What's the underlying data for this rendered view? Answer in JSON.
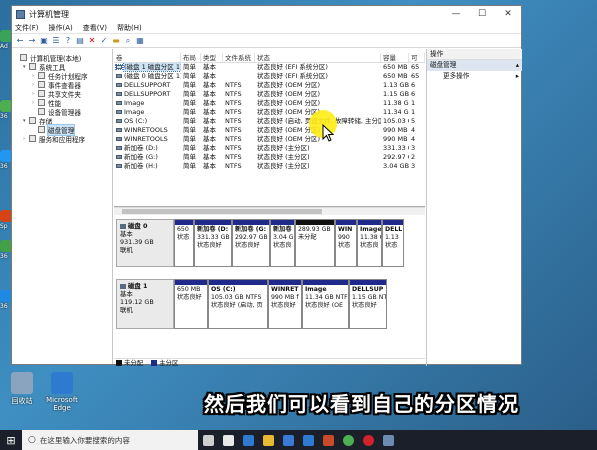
{
  "desktop": {
    "left_icons": [
      "Ad",
      "36",
      "36",
      "Sp",
      "36",
      "36"
    ],
    "bottom_apps": [
      {
        "label": "回收站",
        "color": "#8aa4bf"
      },
      {
        "label": "Microsoft Edge",
        "color": "#2f7ad1"
      }
    ]
  },
  "window": {
    "title": "计算机管理",
    "minimize": "—",
    "maximize": "☐",
    "close": "✕",
    "menu": [
      "文件(F)",
      "操作(A)",
      "查看(V)",
      "帮助(H)"
    ],
    "toolbar_icons": [
      "back-arrow-icon",
      "forward-arrow-icon",
      "folder-icon",
      "list-icon",
      "help-icon",
      "properties-icon",
      "delete-icon",
      "checkmark-icon",
      "open-folder-icon",
      "search-icon",
      "view-icon"
    ]
  },
  "tree": [
    {
      "label": "计算机管理(本地)",
      "indent": 0,
      "expander": ""
    },
    {
      "label": "系统工具",
      "indent": 1,
      "expander": "▾"
    },
    {
      "label": "任务计划程序",
      "indent": 2,
      "expander": "›"
    },
    {
      "label": "事件查看器",
      "indent": 2,
      "expander": "›"
    },
    {
      "label": "共享文件夹",
      "indent": 2,
      "expander": "›"
    },
    {
      "label": "性能",
      "indent": 2,
      "expander": "›"
    },
    {
      "label": "设备管理器",
      "indent": 2,
      "expander": ""
    },
    {
      "label": "存储",
      "indent": 1,
      "expander": "▾"
    },
    {
      "label": "磁盘管理",
      "indent": 2,
      "expander": "",
      "selected": true
    },
    {
      "label": "服务和应用程序",
      "indent": 1,
      "expander": "›"
    }
  ],
  "volume_table": {
    "headers": [
      "卷",
      "布局",
      "类型",
      "文件系统",
      "状态",
      "容量",
      "可"
    ],
    "rows": [
      [
        "(磁盘 1 磁盘分区 1)",
        "简单",
        "基本",
        "",
        "状态良好 (EFI 系统分区)",
        "650 MB",
        "65"
      ],
      [
        "(磁盘 0 磁盘分区 1)",
        "简单",
        "基本",
        "",
        "状态良好 (EFI 系统分区)",
        "650 MB",
        "65"
      ],
      [
        "DELLSUPPORT",
        "简单",
        "基本",
        "NTFS",
        "状态良好 (OEM 分区)",
        "1.13 GB",
        "6"
      ],
      [
        "DELLSUPPORT",
        "简单",
        "基本",
        "NTFS",
        "状态良好 (OEM 分区)",
        "1.15 GB",
        "6"
      ],
      [
        "Image",
        "简单",
        "基本",
        "NTFS",
        "状态良好 (OEM 分区)",
        "11.38 GB",
        "1"
      ],
      [
        "Image",
        "简单",
        "基本",
        "NTFS",
        "状态良好 (OEM 分区)",
        "11.34 GB",
        "1"
      ],
      [
        "OS (C:)",
        "简单",
        "基本",
        "NTFS",
        "状态良好 (启动, 页面文件, 故障转储, 主分区)",
        "105.03 GB",
        "5"
      ],
      [
        "WINRETOOLS",
        "简单",
        "基本",
        "NTFS",
        "状态良好 (OEM 分区)",
        "990 MB",
        "4"
      ],
      [
        "WINRETOOLS",
        "简单",
        "基本",
        "NTFS",
        "状态良好 (OEM 分区)",
        "990 MB",
        "4"
      ],
      [
        "新加卷 (D:)",
        "简单",
        "基本",
        "NTFS",
        "状态良好 (主分区)",
        "331.33 GB",
        "3"
      ],
      [
        "新加卷 (G:)",
        "简单",
        "基本",
        "NTFS",
        "状态良好 (主分区)",
        "292.97 GB",
        "2"
      ],
      [
        "新加卷 (H:)",
        "简单",
        "基本",
        "NTFS",
        "状态良好 (主分区)",
        "3.04 GB",
        "3"
      ]
    ]
  },
  "disks": [
    {
      "name": "磁盘 0",
      "type": "基本",
      "size": "931.39 GB",
      "status": "联机",
      "partitions": [
        {
          "name": "",
          "size": "650",
          "status": "状态",
          "unalloc": false,
          "w": 20
        },
        {
          "name": "新加卷 (D:",
          "size": "331.33 GB",
          "status": "状态良好",
          "unalloc": false,
          "w": 38
        },
        {
          "name": "新加卷 (G:",
          "size": "292.97 GB",
          "status": "状态良好",
          "unalloc": false,
          "w": 38
        },
        {
          "name": "新加卷",
          "size": "3.04 G",
          "status": "状态良",
          "unalloc": false,
          "w": 25
        },
        {
          "name": "",
          "size": "289.93 GB",
          "status": "未分配",
          "unalloc": true,
          "w": 40
        },
        {
          "name": "WIN",
          "size": "990",
          "status": "状态",
          "unalloc": false,
          "w": 22
        },
        {
          "name": "Image",
          "size": "11.38 G",
          "status": "状态良",
          "unalloc": false,
          "w": 25
        },
        {
          "name": "DELL",
          "size": "1.13",
          "status": "状态",
          "unalloc": false,
          "w": 22
        }
      ]
    },
    {
      "name": "磁盘 1",
      "type": "基本",
      "size": "119.12 GB",
      "status": "联机",
      "partitions": [
        {
          "name": "",
          "size": "650 MB",
          "status": "状态良好",
          "unalloc": false,
          "w": 34
        },
        {
          "name": "OS  (C:)",
          "size": "105.03 GB NTFS",
          "status": "状态良好 (启动, 页",
          "unalloc": false,
          "w": 60
        },
        {
          "name": "WINRET",
          "size": "990 MB f",
          "status": "状态良好",
          "unalloc": false,
          "w": 34
        },
        {
          "name": "Image",
          "size": "11.34 GB NTF",
          "status": "状态良好 (OE",
          "unalloc": false,
          "w": 47
        },
        {
          "name": "DELLSUP",
          "size": "1.15 GB NT",
          "status": "状态良好",
          "unalloc": false,
          "w": 38
        }
      ]
    }
  ],
  "legend": [
    {
      "label": "未分配",
      "color": "#111111"
    },
    {
      "label": "主分区",
      "color": "#1f2a8a"
    }
  ],
  "actions": {
    "header": "操作",
    "section": "磁盘管理",
    "item": "更多操作"
  },
  "subtitle": "然后我们可以看到自己的分区情况",
  "taskbar": {
    "search_placeholder": "在这里输入你要搜索的内容",
    "icons": [
      {
        "name": "task-view-icon",
        "color": "#cfcfcf"
      },
      {
        "name": "pinwheel-icon",
        "color": "#e8e8e8"
      },
      {
        "name": "edge-icon",
        "color": "#2f7ad1"
      },
      {
        "name": "file-explorer-icon",
        "color": "#e8b931"
      },
      {
        "name": "store-icon",
        "color": "#3a7bd5"
      },
      {
        "name": "edge-icon-2",
        "color": "#2f7ad1"
      },
      {
        "name": "media-app-icon",
        "color": "#c84a2a"
      },
      {
        "name": "360-icon",
        "color": "#4caf50"
      },
      {
        "name": "record-icon",
        "color": "#d0232b"
      },
      {
        "name": "computer-management-icon",
        "color": "#6b8bb3"
      }
    ]
  }
}
